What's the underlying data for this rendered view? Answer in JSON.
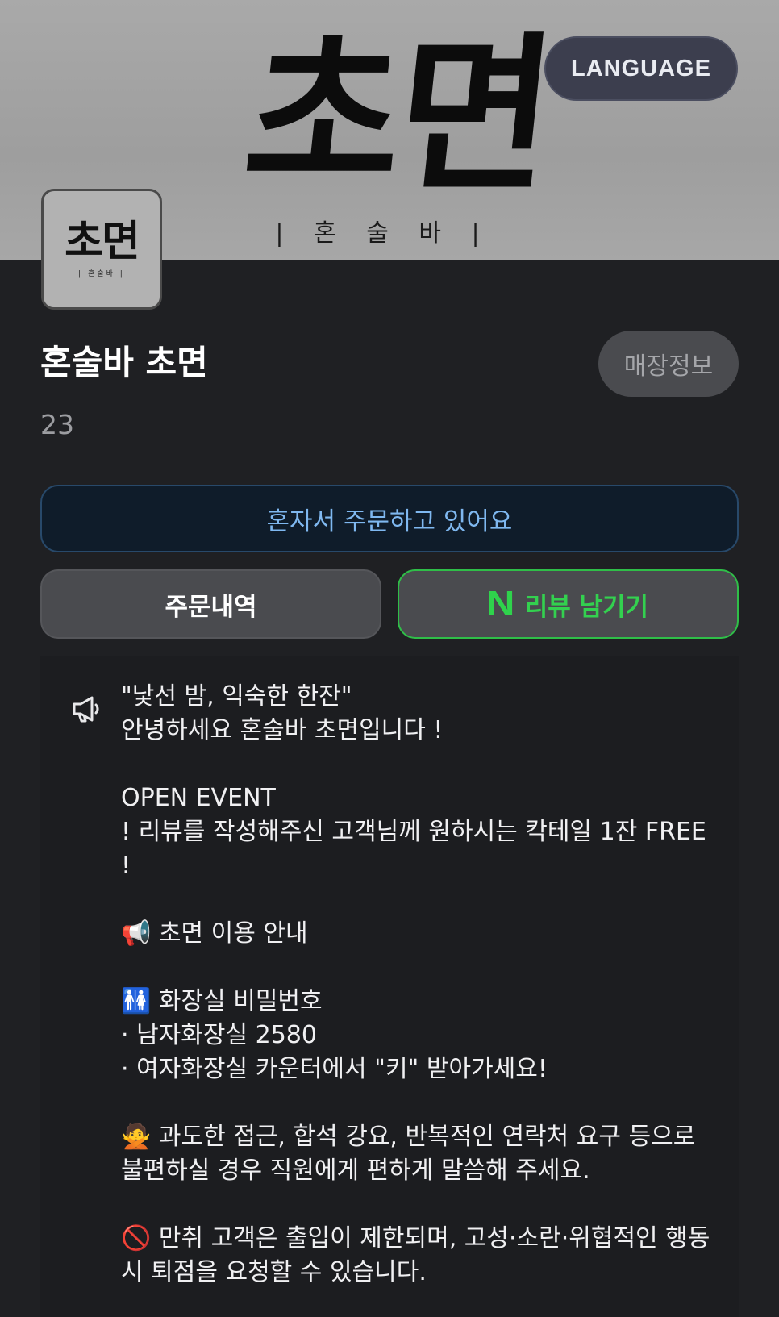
{
  "banner": {
    "logo_text": "초면",
    "sub_text": "| 혼 술 바 |",
    "language_label": "LANGUAGE"
  },
  "thumbnail": {
    "logo_text": "초면",
    "sub_text": "| 혼술바 |"
  },
  "store": {
    "name": "혼술바 초면",
    "info_button": "매장정보",
    "count": "23"
  },
  "solo_order_text": "혼자서 주문하고 있어요",
  "actions": {
    "history_label": "주문내역",
    "review_icon": "N",
    "review_label": "리뷰 남기기"
  },
  "notice": {
    "icon": "megaphone-icon",
    "text": "\"낯선 밤, 익숙한 한잔\"\n안녕하세요 혼술바 초면입니다 !\n\nOPEN EVENT\n! 리뷰를 작성해주신 고객님께 원하시는 칵테일 1잔 FREE !\n\n📢 초면 이용 안내\n\n🚻 화장실 비밀번호\n· 남자화장실 2580\n· 여자화장실 카운터에서 \"키\" 받아가세요!\n\n🙅 과도한 접근, 합석 강요, 반복적인 연락처 요구 등으로 불편하실 경우 직원에게 편하게 말씀해 주세요.\n\n🚫 만취 고객은 출입이 제한되며, 고성·소란·위협적인 행동 시 퇴점을 요청할 수 있습니다."
  },
  "colors": {
    "background": "#1f2023",
    "solo_accent": "#7fb8f0",
    "review_accent": "#33d14f",
    "language_button": "#3c3e4e"
  }
}
